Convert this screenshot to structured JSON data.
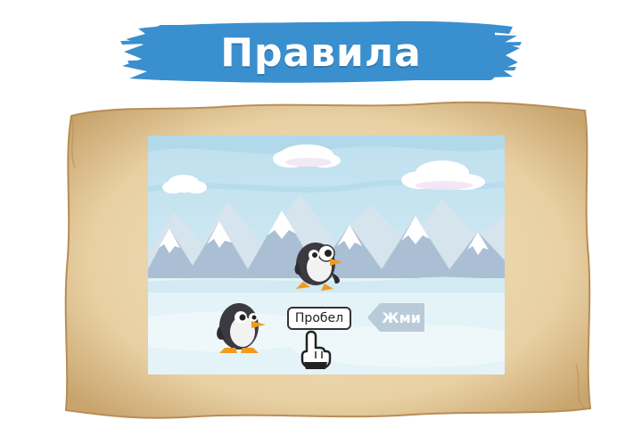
{
  "header": {
    "title": "Правила"
  },
  "tutorial": {
    "key_label": "Пробел",
    "action_label": "Жми"
  },
  "colors": {
    "banner": "#3a8fcf",
    "parchment": "#e8d2a8",
    "sky": "#c9e6f2",
    "snow": "#e6f4f8",
    "press_badge": "#b9cbd9"
  },
  "icons": [
    "brush-banner",
    "parchment-scroll",
    "penguin-jumping",
    "penguin-standing",
    "hand-pointer-icon",
    "arrow-left-badge"
  ]
}
